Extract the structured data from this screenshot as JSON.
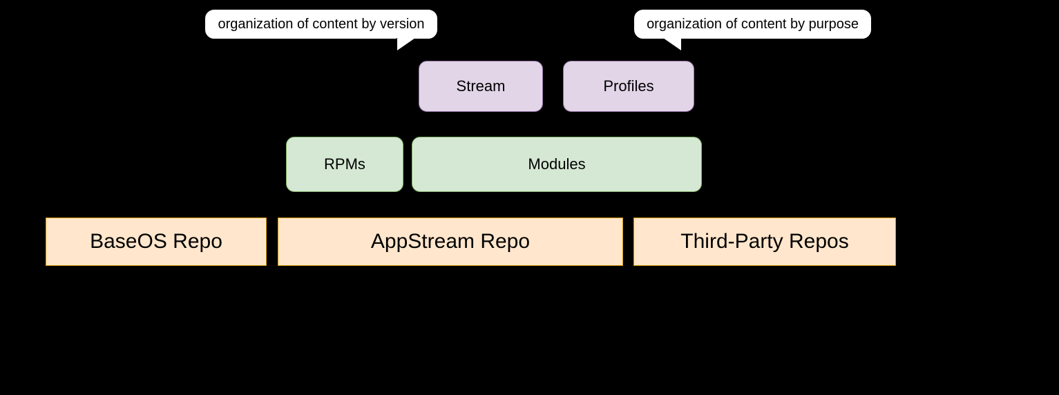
{
  "repos": {
    "baseos": "BaseOS Repo",
    "appstream": "AppStream Repo",
    "thirdparty": "Third-Party Repos"
  },
  "packages": {
    "rpms": "RPMs",
    "modules": "Modules"
  },
  "module_parts": {
    "stream": "Stream",
    "profiles": "Profiles"
  },
  "callouts": {
    "stream": "organization of content by version",
    "profiles": "organization of content by purpose"
  }
}
